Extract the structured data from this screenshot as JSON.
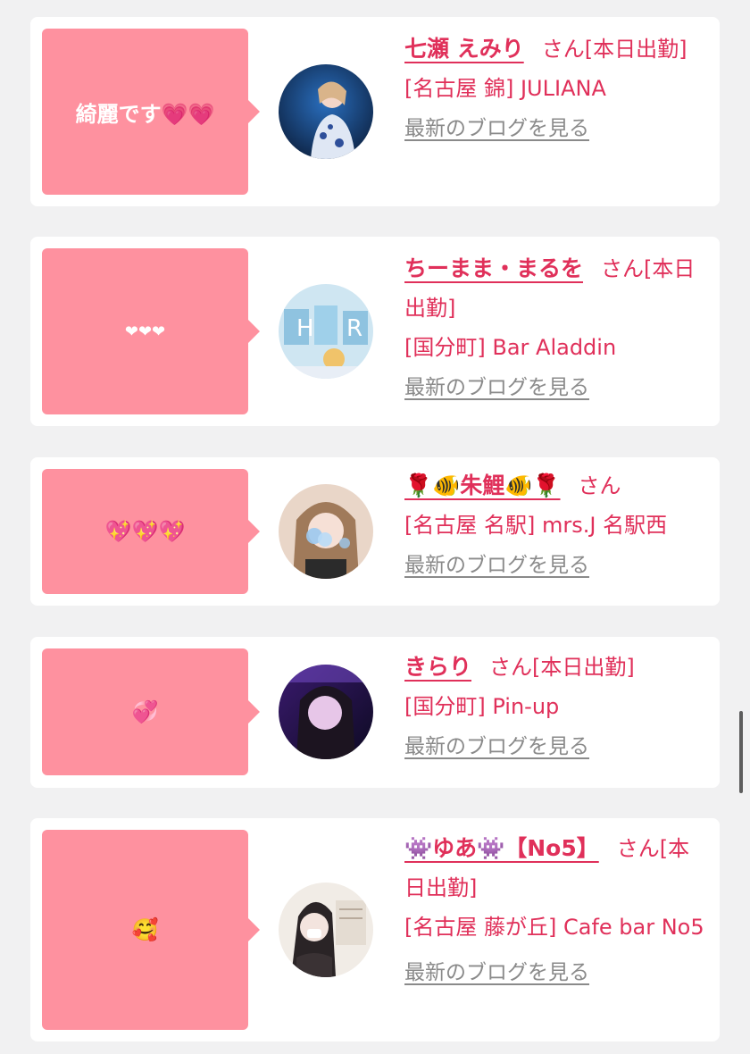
{
  "colors": {
    "background": "#f1f1f2",
    "card": "#ffffff",
    "bubble": "#fe919f",
    "accent_text": "#e0305a",
    "link_grey": "#8a8a8a"
  },
  "cards": [
    {
      "message": "綺麗です💗💗",
      "name": "七瀬 えみり",
      "suffix": "さん[本日出勤]",
      "location": "[名古屋 錦] JULIANA",
      "blog_link": "最新のブログを見る",
      "avatar_icon": "avatar-photo"
    },
    {
      "message": "❤❤❤",
      "name": "ちーまま・まるを",
      "suffix": "さん[本日出勤]",
      "location": "[国分町] Bar Aladdin",
      "blog_link": "最新のブログを見る",
      "avatar_icon": "avatar-photo"
    },
    {
      "message": "💖💖💖",
      "name": "🌹🐠朱鯉🐠🌹",
      "suffix": "さん",
      "location": "[名古屋 名駅] mrs.J 名駅西",
      "blog_link": "最新のブログを見る",
      "avatar_icon": "avatar-photo"
    },
    {
      "message": "💞",
      "name": "きらり",
      "suffix": "さん[本日出勤]",
      "location": "[国分町] Pin-up",
      "blog_link": "最新のブログを見る",
      "avatar_icon": "avatar-photo"
    },
    {
      "message": "🥰",
      "name": "👾ゆあ👾【No5】",
      "suffix": "さん[本日出勤]",
      "location": "[名古屋 藤が丘] Cafe bar No5",
      "blog_link": "最新のブログを見る",
      "avatar_icon": "avatar-photo"
    }
  ]
}
